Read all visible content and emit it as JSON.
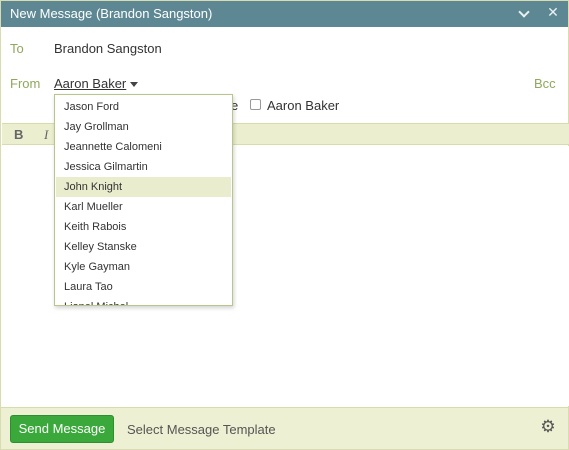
{
  "window": {
    "title": "New Message (Brandon Sangston)"
  },
  "compose": {
    "to_label": "To",
    "to_value": "Brandon Sangston",
    "from_label": "From",
    "from_value": "Aaron Baker",
    "bcc_label": "Bcc",
    "cc_partial_text": "e",
    "cc_checkbox_label": "Aaron Baker"
  },
  "format_bar": {
    "bold_label": "B",
    "italic_label": "I"
  },
  "from_dropdown": {
    "items": [
      "Jason Ford",
      "Jay Grollman",
      "Jeannette Calomeni",
      "Jessica Gilmartin",
      "John Knight",
      "Karl Mueller",
      "Keith Rabois",
      "Kelley Stanske",
      "Kyle Gayman",
      "Laura Tao",
      "Lionel Michel"
    ],
    "highlighted": "John Knight"
  },
  "footer": {
    "send_label": "Send Message",
    "template_label": "Select Message Template"
  },
  "icons": {
    "minimize": "chevron-down-icon",
    "close": "close-icon",
    "from_caret": "caret-down-icon",
    "settings": "gear-icon"
  },
  "colors": {
    "titlebar": "#5d8893",
    "accent_label": "#8fa85c",
    "send_button": "#3aa83a",
    "footer_bg": "#eef0d3",
    "highlight": "#eaecce"
  }
}
